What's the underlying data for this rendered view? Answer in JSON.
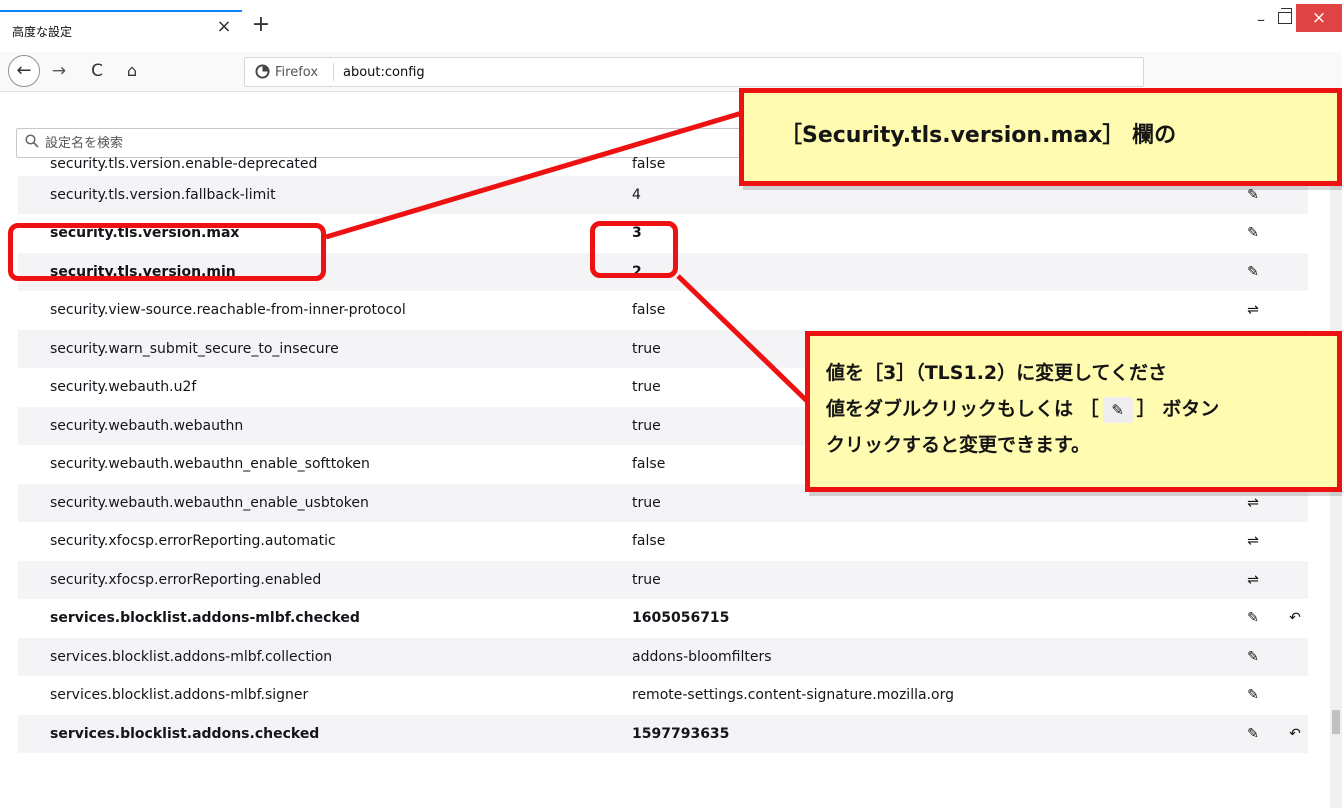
{
  "browser": {
    "tab_title": "高度な設定",
    "tab_close": "×",
    "new_tab": "+",
    "window_minimize": "–",
    "window_close": "×",
    "nav_back": "←",
    "nav_forward": "→",
    "nav_reload": "C",
    "nav_home": "⌂",
    "url_identity_icon": "firefox-icon",
    "url_brand": "Firefox",
    "url": "about:config"
  },
  "config": {
    "search_placeholder": "設定名を検索",
    "rows": [
      {
        "name": "security.tls.version.enable-deprecated",
        "value": "false",
        "modified": false,
        "action": "⇌",
        "reset": ""
      },
      {
        "name": "security.tls.version.fallback-limit",
        "value": "4",
        "modified": false,
        "action": "✎",
        "reset": ""
      },
      {
        "name": "security.tls.version.max",
        "value": "3",
        "modified": true,
        "action": "✎",
        "reset": ""
      },
      {
        "name": "security.tls.version.min",
        "value": "2",
        "modified": true,
        "action": "✎",
        "reset": ""
      },
      {
        "name": "security.view-source.reachable-from-inner-protocol",
        "value": "false",
        "modified": false,
        "action": "⇌",
        "reset": ""
      },
      {
        "name": "security.warn_submit_secure_to_insecure",
        "value": "true",
        "modified": false,
        "action": "⇌",
        "reset": ""
      },
      {
        "name": "security.webauth.u2f",
        "value": "true",
        "modified": false,
        "action": "⇌",
        "reset": ""
      },
      {
        "name": "security.webauth.webauthn",
        "value": "true",
        "modified": false,
        "action": "⇌",
        "reset": ""
      },
      {
        "name": "security.webauth.webauthn_enable_softtoken",
        "value": "false",
        "modified": false,
        "action": "⇌",
        "reset": ""
      },
      {
        "name": "security.webauth.webauthn_enable_usbtoken",
        "value": "true",
        "modified": false,
        "action": "⇌",
        "reset": ""
      },
      {
        "name": "security.xfocsp.errorReporting.automatic",
        "value": "false",
        "modified": false,
        "action": "⇌",
        "reset": ""
      },
      {
        "name": "security.xfocsp.errorReporting.enabled",
        "value": "true",
        "modified": false,
        "action": "⇌",
        "reset": ""
      },
      {
        "name": "services.blocklist.addons-mlbf.checked",
        "value": "1605056715",
        "modified": true,
        "action": "✎",
        "reset": "↶"
      },
      {
        "name": "services.blocklist.addons-mlbf.collection",
        "value": "addons-bloomfilters",
        "modified": false,
        "action": "✎",
        "reset": ""
      },
      {
        "name": "services.blocklist.addons-mlbf.signer",
        "value": "remote-settings.content-signature.mozilla.org",
        "modified": false,
        "action": "✎",
        "reset": ""
      },
      {
        "name": "services.blocklist.addons.checked",
        "value": "1597793635",
        "modified": true,
        "action": "✎",
        "reset": "↶"
      }
    ]
  },
  "annotations": {
    "callout1": "［Security.tls.version.max］ 欄の",
    "callout2_line1": "値を［3］（TLS1.2）に変更してくださ",
    "callout2_line2_pre": "値をダブルクリックもしくは ［",
    "callout2_line2_icon": "pencil-icon",
    "callout2_line2_post": "］ ボタン",
    "callout2_line3": "クリックすると変更できます。",
    "highlight_color": "#ee1111",
    "note_fill": "#fffbb0"
  }
}
